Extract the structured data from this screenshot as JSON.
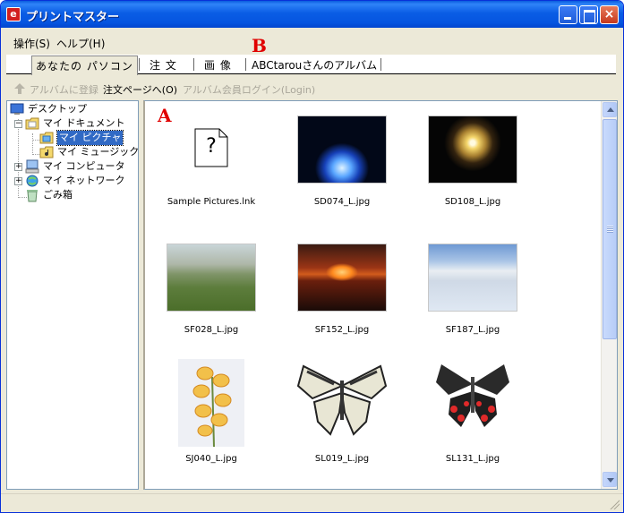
{
  "window": {
    "title": "プリントマスター",
    "app_icon_letter": "e"
  },
  "menu": [
    {
      "label": "操作(S)"
    },
    {
      "label": "ヘルプ(H)"
    }
  ],
  "tabs": [
    {
      "label": "あなたの パソコン",
      "active": true
    },
    {
      "label": "注 文"
    },
    {
      "label": "画 像"
    },
    {
      "label": "ABCtarouさんのアルバム"
    }
  ],
  "markers": {
    "a": "A",
    "b": "B"
  },
  "toolbar": {
    "album_register": "アルバムに登録",
    "order_page": "注文ページへ(O)",
    "album_login": "アルバム会員ログイン(Login)"
  },
  "tree": [
    {
      "label": "デスクトップ",
      "icon": "desktop-icon"
    },
    {
      "label": "マイ ドキュメント",
      "icon": "my-documents-icon"
    },
    {
      "label": "マイ ピクチャ",
      "icon": "my-pictures-icon",
      "selected": true
    },
    {
      "label": "マイ ミュージック",
      "icon": "my-music-icon"
    },
    {
      "label": "マイ コンピュータ",
      "icon": "my-computer-icon"
    },
    {
      "label": "マイ ネットワーク",
      "icon": "my-network-icon"
    },
    {
      "label": "ごみ箱",
      "icon": "recycle-bin-icon"
    }
  ],
  "files": [
    {
      "name": "Sample Pictures.lnk",
      "kind": "unknown-file-icon"
    },
    {
      "name": "SD074_L.jpg",
      "kind": "blue-flame"
    },
    {
      "name": "SD108_L.jpg",
      "kind": "fireworks"
    },
    {
      "name": "SF028_L.jpg",
      "kind": "green-valley"
    },
    {
      "name": "SF152_L.jpg",
      "kind": "sunset-sea"
    },
    {
      "name": "SF187_L.jpg",
      "kind": "snow-field"
    },
    {
      "name": "SJ040_L.jpg",
      "kind": "orchid"
    },
    {
      "name": "SL019_L.jpg",
      "kind": "swallowtail-butterfly"
    },
    {
      "name": "SL131_L.jpg",
      "kind": "red-black-butterfly"
    }
  ],
  "unknown_glyph": "?"
}
